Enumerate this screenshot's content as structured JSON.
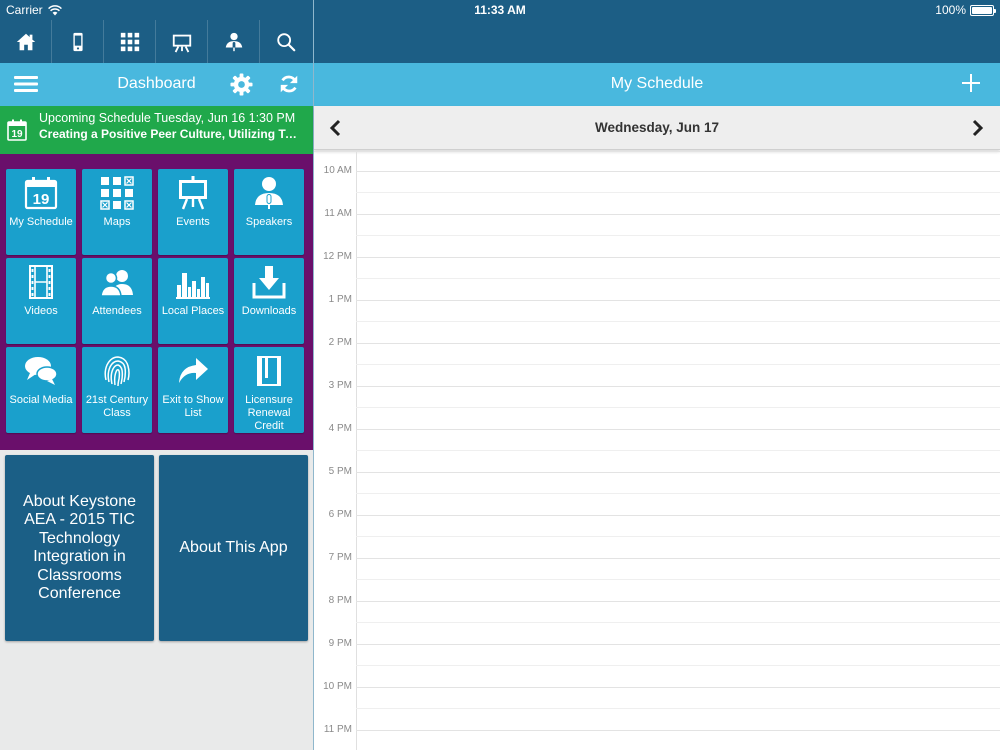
{
  "status_bar": {
    "carrier": "Carrier",
    "time": "11:33 AM",
    "battery": "100%",
    "battery_level": 1.0
  },
  "nav_icons": [
    "home-icon",
    "device-icon",
    "grid-icon",
    "easel-icon",
    "speaker-icon",
    "search-icon"
  ],
  "dashboard": {
    "title": "Dashboard"
  },
  "upcoming": {
    "line1": "Upcoming Schedule Tuesday, Jun 16 1:30 PM",
    "line2": "Creating a Positive Peer Culture, Utilizing Technology"
  },
  "tiles": [
    {
      "label": "My Schedule",
      "icon": "calendar-icon"
    },
    {
      "label": "Maps",
      "icon": "grid-map-icon"
    },
    {
      "label": "Events",
      "icon": "easel-icon"
    },
    {
      "label": "Speakers",
      "icon": "speaker-icon"
    },
    {
      "label": "Videos",
      "icon": "film-icon"
    },
    {
      "label": "Attendees",
      "icon": "people-icon"
    },
    {
      "label": "Local Places",
      "icon": "city-icon"
    },
    {
      "label": "Downloads",
      "icon": "download-icon"
    },
    {
      "label": "Social Media",
      "icon": "chat-bubbles-icon"
    },
    {
      "label": "21st Century Class",
      "icon": "fingerprint-icon"
    },
    {
      "label": "Exit to Show List",
      "icon": "share-arrow-icon"
    },
    {
      "label": "Licensure Renewal Credit",
      "icon": "book-icon"
    }
  ],
  "about_cards": [
    {
      "label": "About Keystone AEA - 2015 TIC Technology Integration in Classrooms Conference"
    },
    {
      "label": "About This App"
    }
  ],
  "schedule": {
    "title": "My Schedule",
    "date": "Wednesday, Jun 17",
    "hours": [
      "10 AM",
      "11 AM",
      "12 PM",
      "1 PM",
      "2 PM",
      "3 PM",
      "4 PM",
      "5 PM",
      "6 PM",
      "7 PM",
      "8 PM",
      "9 PM",
      "10 PM",
      "11 PM"
    ]
  },
  "colors": {
    "nav_dark": "#1c5e85",
    "header_light": "#49b8de",
    "upcoming_green": "#20a84b",
    "tile_blue": "#1aa0cc",
    "tile_bg_purple": "#6a0f6b"
  }
}
